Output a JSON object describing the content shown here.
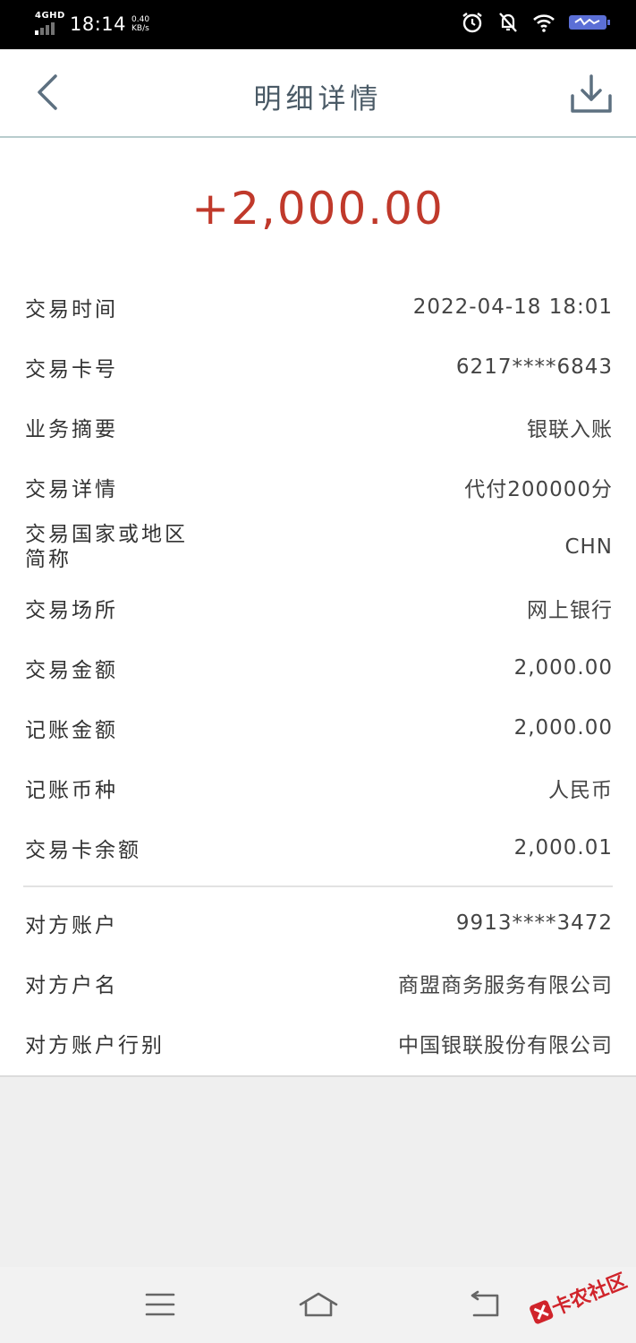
{
  "status_bar": {
    "network": "4GHD",
    "time": "18:14",
    "speed_value": "0.40",
    "speed_unit": "KB/s"
  },
  "header": {
    "title": "明细详情"
  },
  "amount": "+2,000.00",
  "colors": {
    "amount": "#c0392b",
    "title": "#4a5a66",
    "header_border": "#b8cccd"
  },
  "details": [
    {
      "label": "交易时间",
      "value": "2022-04-18  18:01"
    },
    {
      "label": "交易卡号",
      "value": "6217****6843"
    },
    {
      "label": "业务摘要",
      "value": "银联入账"
    },
    {
      "label": "交易详情",
      "value": "代付200000分"
    },
    {
      "label": "交易国家或地区简称",
      "value": "CHN"
    },
    {
      "label": "交易场所",
      "value": "网上银行"
    },
    {
      "label": "交易金额",
      "value": "2,000.00"
    },
    {
      "label": "记账金额",
      "value": "2,000.00"
    },
    {
      "label": "记账币种",
      "value": "人民币"
    },
    {
      "label": "交易卡余额",
      "value": "2,000.01"
    }
  ],
  "counterparty": [
    {
      "label": "对方账户",
      "value": "9913****3472"
    },
    {
      "label": "对方户名",
      "value": "商盟商务服务有限公司"
    },
    {
      "label": "对方账户行别",
      "value": "中国银联股份有限公司"
    }
  ],
  "watermark": "卡农社区",
  "icons": {
    "back": "chevron-left-icon",
    "download": "download-icon",
    "menu": "menu-icon",
    "home": "home-icon",
    "return": "return-icon"
  }
}
